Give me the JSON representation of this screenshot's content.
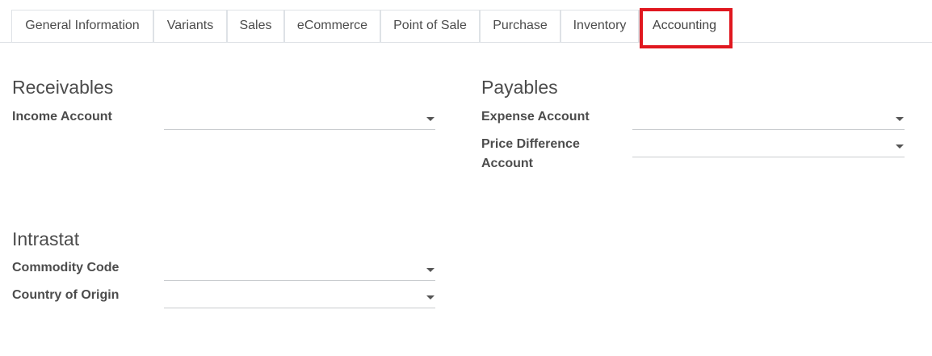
{
  "tabs": [
    {
      "label": "General Information"
    },
    {
      "label": "Variants"
    },
    {
      "label": "Sales"
    },
    {
      "label": "eCommerce"
    },
    {
      "label": "Point of Sale"
    },
    {
      "label": "Purchase"
    },
    {
      "label": "Inventory"
    },
    {
      "label": "Accounting",
      "active": true
    }
  ],
  "highlight_color": "#e0171f",
  "receivables": {
    "title": "Receivables",
    "income_account": {
      "label": "Income Account",
      "value": ""
    }
  },
  "payables": {
    "title": "Payables",
    "expense_account": {
      "label": "Expense Account",
      "value": ""
    },
    "price_difference_account": {
      "label_line1": "Price Difference",
      "label_line2": "Account",
      "value": ""
    }
  },
  "intrastat": {
    "title": "Intrastat",
    "commodity_code": {
      "label": "Commodity Code",
      "value": ""
    },
    "country_of_origin": {
      "label": "Country of Origin",
      "value": ""
    }
  },
  "icons": {
    "dropdown": "caret-down-icon"
  }
}
